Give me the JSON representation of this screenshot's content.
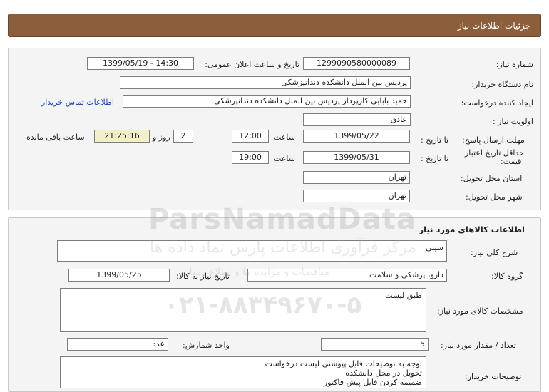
{
  "header": {
    "title": "جزئیات اطلاعات نیاز"
  },
  "info": {
    "need_number_label": "شماره نیاز:",
    "need_number": "1299090580000089",
    "announce_label": "تاریخ و ساعت اعلان عمومی:",
    "announce_value": "1399/05/19 - 14:30",
    "buyer_label": "نام دستگاه خریدار:",
    "buyer_value": "پردیس بین الملل دانشکده دندانپزشکی",
    "requester_label": "ایجاد کننده درخواست:",
    "requester_value": "حمید بابایی کارپرداز پردیس بین الملل دانشکده دندانپزشکی",
    "contact_link": "اطلاعات تماس خریدار",
    "priority_label": "اولویت نیاز :",
    "priority_value": "عادی",
    "deadline_label": "مهلت ارسال پاسخ:",
    "to_date_label": "تا تاریخ :",
    "deadline_date": "1399/05/22",
    "time_label": "ساعت",
    "deadline_time": "12:00",
    "days_value": "2",
    "days_label": "روز و",
    "remaining_time": "21:25:16",
    "remaining_label": "ساعت باقی مانده",
    "validity_label_1": "حداقل تاریخ اعتبار",
    "validity_label_2": "قیمت:",
    "validity_to_label": "تا تاریخ :",
    "validity_date": "1399/05/31",
    "validity_time_label": "ساعت",
    "validity_time": "19:00",
    "province_label": "استان محل تحویل:",
    "province_value": "تهران",
    "city_label": "شهر محل تحویل:",
    "city_value": "تهران"
  },
  "goods": {
    "title": "اطلاعات کالاهای مورد نیاز",
    "summary_label": "شرح کلی نیاز:",
    "summary_value": "سینی",
    "group_label": "گروه کالا:",
    "group_value": "دارو، پزشکی و سلامت",
    "need_date_label": "تاریخ نیاز به کالا:",
    "need_date_value": "1399/05/25",
    "specs_label": "مشخصات کالای مورد نیاز:",
    "specs_value": "طبق لیست",
    "qty_label": "تعداد / مقدار مورد نیاز:",
    "qty_value": "5",
    "unit_label": "واحد شمارش:",
    "unit_value": "عدد",
    "buyer_notes_label": "توضیحات خریدار:",
    "buyer_notes": [
      "توجه به توضیحات فایل پیوستی لیست درخواست",
      "تحویل در محل دانشکده",
      "ضمیمه کردن فایل پیش فاکتور"
    ]
  },
  "watermark": {
    "line1": "ParsNamadData",
    "line2": "مرکز فرآوری اطلاعات پارس نماد داده ها",
    "line3": "۰۲۱-۸۸۳۴۹۶۷۰-۵",
    "line4": "مناقصات و مزایده ها و اطلاع رسانی"
  }
}
